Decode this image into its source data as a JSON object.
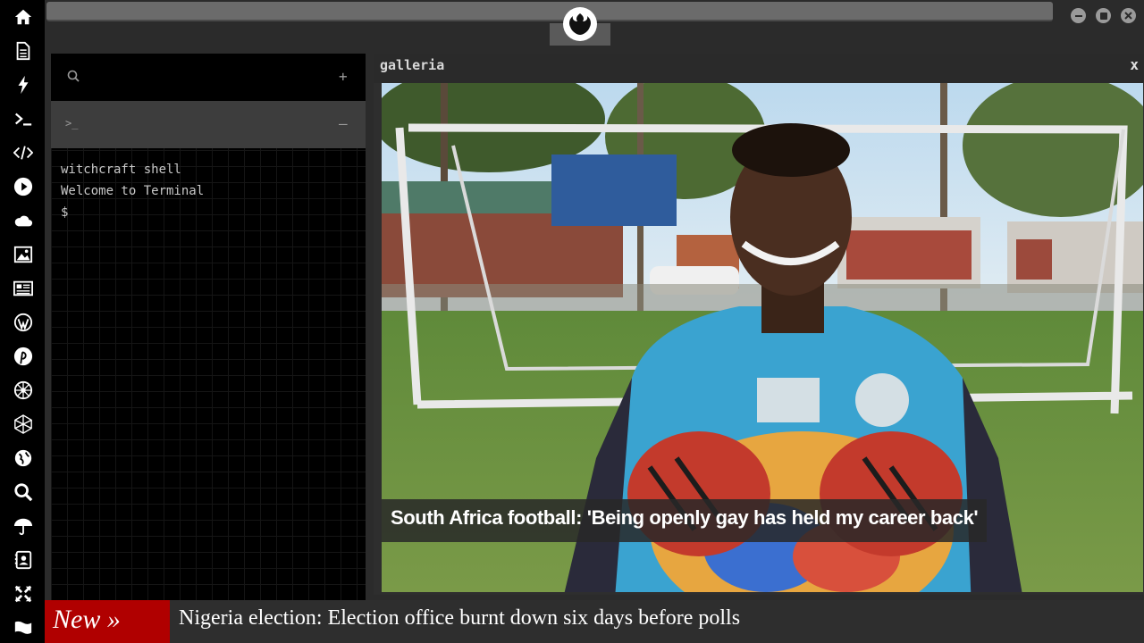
{
  "sidebar": {
    "icons": [
      "home-icon",
      "document-icon",
      "bolt-icon",
      "terminal-icon",
      "code-icon",
      "play-icon",
      "cloud-icon",
      "image-icon",
      "newspaper-icon",
      "wordpress-icon",
      "pinterest-icon",
      "settings-wheel-icon",
      "globe-mesh-icon",
      "globe-icon",
      "search-icon",
      "umbrella-icon",
      "contacts-icon",
      "expand-icon",
      "flag-icon"
    ]
  },
  "terminal": {
    "search_icon": "search-icon",
    "add_label": "+",
    "prompt_symbol": ">_",
    "collapse_label": "–",
    "lines": [
      "witchcraft shell",
      "Welcome to Terminal",
      "$"
    ]
  },
  "galleria": {
    "title": "galleria",
    "close_label": "x",
    "caption": "South Africa football: 'Being openly gay has held my career back'"
  },
  "ticker": {
    "badge": "New »",
    "headline": "Nigeria election: Election office burnt down six days before polls"
  },
  "colors": {
    "sidebar_bg": "#000000",
    "ticker_badge": "#b00000",
    "panel_bg": "#2b2b2b"
  }
}
